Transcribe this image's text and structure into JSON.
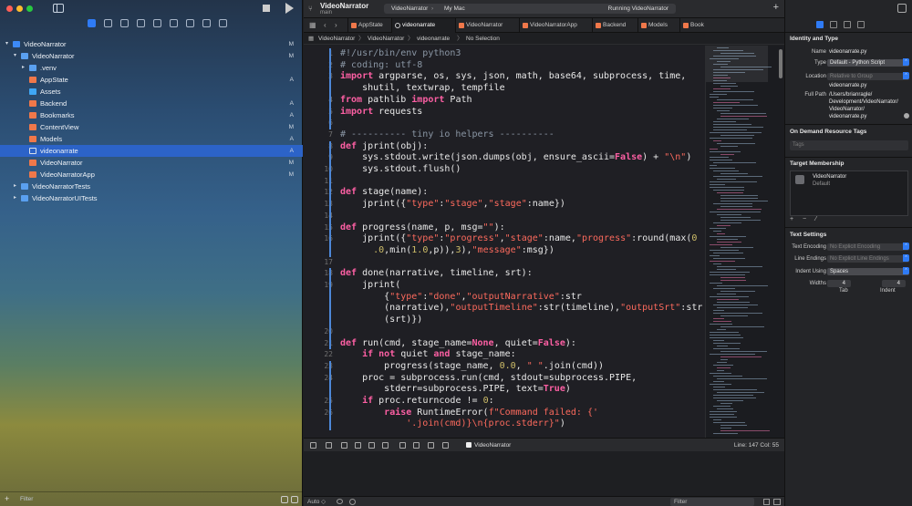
{
  "window": {
    "project_title": "VideoNarrator",
    "project_branch": "main",
    "scheme": "VideoNarrator",
    "destination": "My Mac",
    "status": "Running VideoNarrator",
    "add_symbol": "+"
  },
  "navigator": {
    "items": [
      {
        "label": "VideoNarrator",
        "badge": "M",
        "level": 0,
        "disclosure": "▾",
        "icon": "project-icon"
      },
      {
        "label": "VideoNarrator",
        "badge": "M",
        "level": 1,
        "disclosure": "▾",
        "icon": "folder-icon"
      },
      {
        "label": ".venv",
        "badge": "",
        "level": 2,
        "disclosure": "▸",
        "icon": "folder-icon"
      },
      {
        "label": "AppState",
        "badge": "A",
        "level": 2,
        "disclosure": "",
        "icon": "swift-file-icon"
      },
      {
        "label": "Assets",
        "badge": "",
        "level": 2,
        "disclosure": "",
        "icon": "assets-icon"
      },
      {
        "label": "Backend",
        "badge": "A",
        "level": 2,
        "disclosure": "",
        "icon": "swift-file-icon"
      },
      {
        "label": "Bookmarks",
        "badge": "A",
        "level": 2,
        "disclosure": "",
        "icon": "swift-file-icon"
      },
      {
        "label": "ContentView",
        "badge": "M",
        "level": 2,
        "disclosure": "",
        "icon": "swift-file-icon"
      },
      {
        "label": "Models",
        "badge": "A",
        "level": 2,
        "disclosure": "",
        "icon": "swift-file-icon"
      },
      {
        "label": "videonarrate",
        "badge": "A",
        "level": 2,
        "disclosure": "",
        "icon": "python-file-icon"
      },
      {
        "label": "VideoNarrator",
        "badge": "M",
        "level": 2,
        "disclosure": "",
        "icon": "swift-file-icon"
      },
      {
        "label": "VideoNarratorApp",
        "badge": "M",
        "level": 2,
        "disclosure": "",
        "icon": "swift-file-icon"
      },
      {
        "label": "VideoNarratorTests",
        "badge": "",
        "level": 1,
        "disclosure": "▸",
        "icon": "folder-icon"
      },
      {
        "label": "VideoNarratorUITests",
        "badge": "",
        "level": 1,
        "disclosure": "▸",
        "icon": "folder-icon"
      }
    ],
    "selected_index": 9,
    "filter_placeholder": "Filter"
  },
  "tabs": [
    {
      "label": "AppState",
      "kind": "swift"
    },
    {
      "label": "videonarrate",
      "kind": "python",
      "active": true
    },
    {
      "label": "VideoNarrator",
      "kind": "swift"
    },
    {
      "label": "VideoNarratorApp",
      "kind": "swift"
    },
    {
      "label": "Backend",
      "kind": "swift"
    },
    {
      "label": "Models",
      "kind": "swift"
    },
    {
      "label": "Book",
      "kind": "swift"
    }
  ],
  "jumpbar": {
    "crumbs": [
      "VideoNarrator",
      "VideoNarrator",
      "videonarrate",
      "No Selection"
    ],
    "separator": "〉"
  },
  "editor": {
    "lines": [
      {
        "n": "1",
        "code": "#!/usr/bin/env python3",
        "cls": "cm"
      },
      {
        "n": "2",
        "code": "# coding: utf-8",
        "cls": "cm"
      },
      {
        "n": "3",
        "code": "",
        "html": "<span class='kw'>import</span> argparse, os, sys, json, math, base64, subprocess, time,"
      },
      {
        "n": "",
        "code": "    shutil, textwrap, tempfile"
      },
      {
        "n": "4",
        "code": "",
        "html": "<span class='kw'>from</span> pathlib <span class='kw'>import</span> Path"
      },
      {
        "n": "5",
        "code": "",
        "html": "<span class='kw'>import</span> requests"
      },
      {
        "n": "6",
        "code": ""
      },
      {
        "n": "7",
        "code": "# ---------- tiny io helpers ----------",
        "cls": "cm"
      },
      {
        "n": "8",
        "code": "",
        "html": "<span class='kw'>def</span> jprint(obj):"
      },
      {
        "n": "9",
        "code": "",
        "html": "    sys.stdout.write(json.dumps(obj, ensure_ascii=<span class='kw'>False</span>) + <span class='st'>\"\\n\"</span>)"
      },
      {
        "n": "10",
        "code": "    sys.stdout.flush()"
      },
      {
        "n": "11",
        "code": ""
      },
      {
        "n": "12",
        "code": "",
        "html": "<span class='kw'>def</span> stage(name):"
      },
      {
        "n": "13",
        "code": "",
        "html": "    jprint({<span class='st'>\"type\"</span>:<span class='st'>\"stage\"</span>,<span class='st'>\"stage\"</span>:name})"
      },
      {
        "n": "14",
        "code": ""
      },
      {
        "n": "15",
        "code": "",
        "html": "<span class='kw'>def</span> progress(name, p, msg=<span class='st'>\"\"</span>):"
      },
      {
        "n": "16",
        "code": "",
        "html": "    jprint({<span class='st'>\"type\"</span>:<span class='st'>\"progress\"</span>,<span class='st'>\"stage\"</span>:name,<span class='st'>\"progress\"</span>:round(max(<span class='nu'>0</span>"
      },
      {
        "n": "",
        "code": "",
        "html": "      <span class='nu'>.0</span>,min(<span class='nu'>1.0</span>,p)),<span class='nu'>3</span>),<span class='st'>\"message\"</span>:msg})"
      },
      {
        "n": "17",
        "code": ""
      },
      {
        "n": "18",
        "code": "",
        "html": "<span class='kw'>def</span> done(narrative, timeline, srt):"
      },
      {
        "n": "19",
        "code": "    jprint("
      },
      {
        "n": "",
        "code": "",
        "html": "        {<span class='st'>\"type\"</span>:<span class='st'>\"done\"</span>,<span class='st'>\"outputNarrative\"</span>:str"
      },
      {
        "n": "",
        "code": "",
        "html": "        (narrative),<span class='st'>\"outputTimeline\"</span>:str(timeline),<span class='st'>\"outputSrt\"</span>:str"
      },
      {
        "n": "",
        "code": "        (srt)})"
      },
      {
        "n": "20",
        "code": ""
      },
      {
        "n": "21",
        "code": "",
        "html": "<span class='kw'>def</span> run(cmd, stage_name=<span class='kw'>None</span>, quiet=<span class='kw'>False</span>):"
      },
      {
        "n": "22",
        "code": "",
        "html": "    <span class='kw'>if not</span> quiet <span class='kw'>and</span> stage_name:"
      },
      {
        "n": "23",
        "code": "",
        "html": "        progress(stage_name, <span class='nu'>0.0</span>, <span class='st'>\" \"</span>.join(cmd))"
      },
      {
        "n": "24",
        "code": "    proc = subprocess.run(cmd, stdout=subprocess.PIPE,"
      },
      {
        "n": "",
        "code": "",
        "html": "        stderr=subprocess.PIPE, text=<span class='kw'>True</span>)"
      },
      {
        "n": "25",
        "code": "",
        "html": "    <span class='kw'>if</span> proc.returncode != <span class='nu'>0</span>:"
      },
      {
        "n": "26",
        "code": "",
        "html": "        <span class='kw'>raise</span> RuntimeError(<span class='st'>f\"Command failed: {'</span>"
      },
      {
        "n": "",
        "code": "",
        "html": "<span class='st'>            '.join(cmd)}\\n{proc.stderr}\"</span>)"
      }
    ]
  },
  "debug": {
    "target": "VideoNarrator",
    "position": "Line: 147  Col: 55"
  },
  "bottombar": {
    "output_mode": "Auto ◇",
    "filter_placeholder": "Filter"
  },
  "inspector": {
    "identity_title": "Identity and Type",
    "name_label": "Name",
    "name_value": "videonarrate.py",
    "type_label": "Type",
    "type_value": "Default - Python Script",
    "location_label": "Location",
    "location_value": "Relative to Group",
    "location_file": "videonarrate.py",
    "fullpath_label": "Full Path",
    "fullpath_lines": [
      "/Users/brianragle/",
      "Development/VideoNarrator/",
      "VideoNarrator/",
      "videonarrate.py"
    ],
    "ondemand_title": "On Demand Resource Tags",
    "tags_placeholder": "Tags",
    "membership_title": "Target Membership",
    "member_name": "VideoNarrator",
    "member_sub": "Default",
    "member_buttons": [
      "+",
      "−",
      "⁄"
    ],
    "text_settings_title": "Text Settings",
    "encoding_label": "Text Encoding",
    "encoding_value": "No Explicit Encoding",
    "endings_label": "Line Endings",
    "endings_value": "No Explicit Line Endings",
    "indent_label": "Indent Using",
    "indent_value": "Spaces",
    "widths_label": "Widths",
    "tab_width": "4",
    "indent_width": "4",
    "tab_label": "Tab",
    "indent_sub_label": "Indent"
  },
  "colors": {
    "accent": "#2f7bf5",
    "keyword": "#fc5fa3",
    "string": "#fc6a5d",
    "comment": "#8a96a4",
    "number": "#d0bf69"
  }
}
